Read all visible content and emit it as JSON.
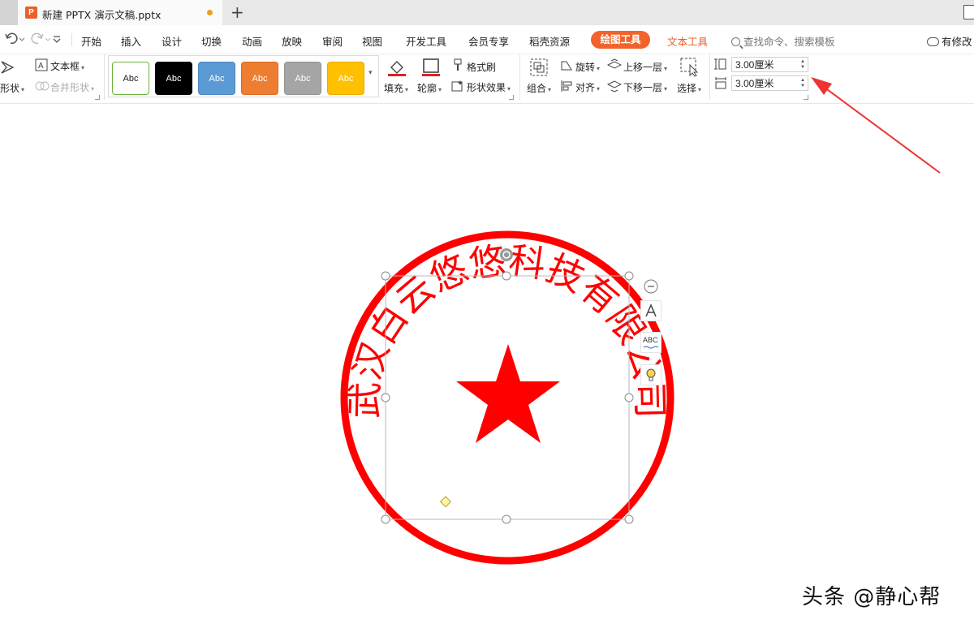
{
  "titlebar": {
    "doc_icon": "ppt-icon",
    "doc_name": "新建 PPTX 演示文稿.pptx",
    "new_tab": "+"
  },
  "menubar": {
    "undo_icon": "undo-icon",
    "redo_icon": "redo-icon",
    "more_icon": "chevron-down-icon",
    "items": [
      "开始",
      "插入",
      "设计",
      "切换",
      "动画",
      "放映",
      "审阅",
      "视图",
      "开发工具",
      "会员专享",
      "稻壳资源"
    ],
    "active_item": "绘图工具",
    "text_tool": "文本工具",
    "search_placeholder": "查找命令、搜索模板",
    "account": "有修改"
  },
  "ribbon": {
    "shape_partial": "形状",
    "textbox": "文本框",
    "merge_shape": "合并形状",
    "style_label": "Abc",
    "styles": [
      {
        "bg": "#ffffff",
        "border": "#6cb33e",
        "fg": "#222222"
      },
      {
        "bg": "#000000",
        "border": "#000000",
        "fg": "#ffffff"
      },
      {
        "bg": "#5b9bd5",
        "border": "#4a86bf",
        "fg": "#ffffff"
      },
      {
        "bg": "#ed7d31",
        "border": "#d86a22",
        "fg": "#ffffff"
      },
      {
        "bg": "#a5a5a5",
        "border": "#929292",
        "fg": "#ffffff"
      },
      {
        "bg": "#ffc000",
        "border": "#e6ad00",
        "fg": "#ffffff"
      }
    ],
    "fill": "填充",
    "outline": "轮廓",
    "format_painter": "格式刷",
    "shape_effect": "形状效果",
    "group": "组合",
    "rotate": "旋转",
    "align": "对齐",
    "bring_forward": "上移一层",
    "send_backward": "下移一层",
    "select": "选择",
    "height_value": "3.00厘米",
    "width_value": "3.00厘米"
  },
  "canvas": {
    "seal_text": "武汉白云悠悠科技有限公司",
    "seal_color": "#ff0000",
    "side_tools": [
      "minus-circle-icon",
      "text-style-icon",
      "spell-check-icon",
      "lightbulb-icon"
    ],
    "side_tool_abc": "ABC",
    "arrow_color": "#ee3333"
  },
  "watermark": "头条 @静心帮"
}
